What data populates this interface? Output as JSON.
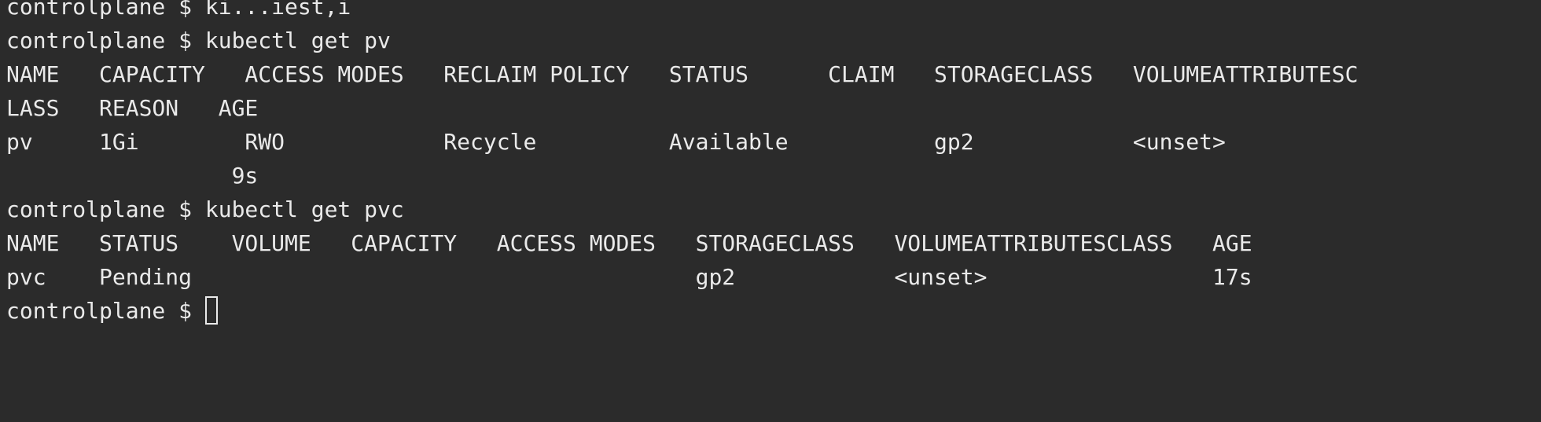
{
  "terminal": {
    "cut_line": "controlplane $ ki...iest,i",
    "lines": [
      "controlplane $ kubectl get pv",
      "NAME   CAPACITY   ACCESS MODES   RECLAIM POLICY   STATUS      CLAIM   STORAGECLASS   VOLUMEATTRIBUTESC",
      "LASS   REASON   AGE",
      "pv     1Gi        RWO            Recycle          Available           gp2            <unset>",
      "                 9s",
      "controlplane $ kubectl get pvc",
      "NAME   STATUS    VOLUME   CAPACITY   ACCESS MODES   STORAGECLASS   VOLUMEATTRIBUTESCLASS   AGE",
      "pvc    Pending                                      gp2            <unset>                 17s",
      "controlplane $ "
    ]
  }
}
